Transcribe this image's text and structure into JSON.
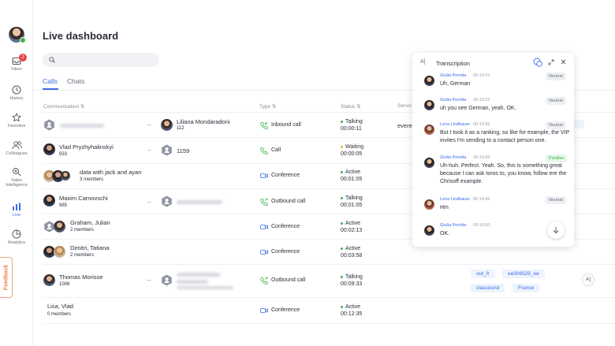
{
  "sidebar": {
    "items": [
      {
        "label": "Inbox",
        "badge": "2",
        "icon": "inbox-icon"
      },
      {
        "label": "History",
        "icon": "clock-icon"
      },
      {
        "label": "Favorites",
        "icon": "star-icon"
      },
      {
        "label": "Colleagues",
        "icon": "people-icon"
      },
      {
        "label": "Sales Intelligence",
        "icon": "sparkle-icon"
      },
      {
        "label": "Live",
        "icon": "bar-chart-icon",
        "active": true
      },
      {
        "label": "Analytics",
        "icon": "pie-icon"
      }
    ],
    "feedback": "Feedback"
  },
  "page": {
    "title": "Live dashboard"
  },
  "tabs": [
    {
      "label": "Calls",
      "active": true
    },
    {
      "label": "Chats"
    }
  ],
  "columns": {
    "communication": "Communication",
    "type": "Type",
    "status": "Status",
    "service": "Servic"
  },
  "rows": [
    {
      "name": "",
      "sub": "",
      "target_name": "Liliana Mondaradoni",
      "target_sub": "112",
      "type": "Inbound call",
      "status": "Talking",
      "time": "00:00:11",
      "service": "evere"
    },
    {
      "name": "Vlad Pryzhyhalinskyi",
      "sub": "933",
      "target_name": "1159",
      "type": "Call",
      "status": "Waiting",
      "time": "00:00:05"
    },
    {
      "name": "data with jack and ayan",
      "sub": "3 members",
      "type": "Conference",
      "status": "Active",
      "time": "00:01:05"
    },
    {
      "name": "Maxim Carnovschi",
      "sub": "985",
      "type": "Outbound call",
      "status": "Talking",
      "time": "00:01:05"
    },
    {
      "name": "Graham, Julian",
      "sub": "2 members",
      "type": "Conference",
      "status": "Active",
      "time": "00:02:13"
    },
    {
      "name": "Dimitri, Tatiana",
      "sub": "2 members",
      "type": "Conference",
      "status": "Active",
      "time": "00:03:58"
    },
    {
      "name": "Thomas Morisse",
      "sub": "1006",
      "type": "Outbound call",
      "status": "Talking",
      "time": "00:09:33",
      "tags": [
        "out_fr",
        "ee006529_ee",
        "classound",
        "France"
      ]
    },
    {
      "name": "Lisa, Vlad",
      "sub": "0 members",
      "type": "Conference",
      "status": "Active",
      "time": "00:12:35"
    }
  ],
  "transcription": {
    "ai_label": "A]",
    "title": "Transcription",
    "messages": [
      {
        "speaker": "Giulia Perotta",
        "time": "00:19:31",
        "sentiment": "Neutral",
        "text": "Uh, German"
      },
      {
        "speaker": "Giulia Perotta",
        "time": "00:19:32",
        "sentiment": "Neutral",
        "text": "uh you see German, yeah, OK."
      },
      {
        "speaker": "Lena Lindbauer",
        "time": "00:19:36",
        "sentiment": "Neutral",
        "text": "But I took it as a ranking, so like for example, the VIP invites I'm sending to a contact person one."
      },
      {
        "speaker": "Giulia Perotta",
        "time": "00:19:39",
        "sentiment": "Positive",
        "text": "Uh-huh. Perfect. Yeah. So, this is something great because I can ask toros to, you know, follow ere the Chrisoff example."
      },
      {
        "speaker": "Lena Lindbauer",
        "time": "00:19:46",
        "sentiment": "Neutral",
        "text": "Hm"
      },
      {
        "speaker": "Giulia Perotta",
        "time": "00:19:50",
        "sentiment": "",
        "text": "OK."
      }
    ]
  },
  "row_action_label": "A]"
}
